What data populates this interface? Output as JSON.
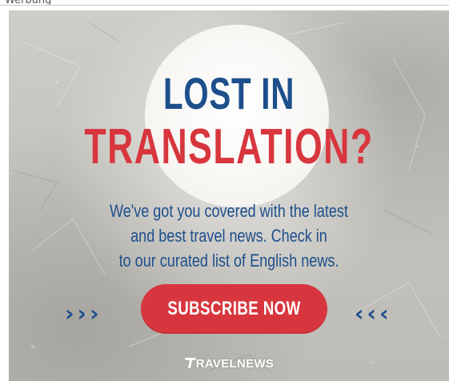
{
  "page": {
    "ad_label": "Werbung"
  },
  "banner": {
    "headline_line1": "LOST IN",
    "headline_line2": "TRANSLATION?",
    "body_line1": "We've got you covered with the latest",
    "body_line2": "and best travel news. Check in",
    "body_line3": "to our curated list of English news.",
    "chevrons_left": "›››",
    "chevrons_right": "‹‹‹",
    "cta_label": "SUBSCRIBE NOW",
    "logo_text": "RAVELNEWS",
    "logo_icon": "travelnews-t-logo-icon",
    "colors": {
      "blue": "#1d4f8c",
      "red": "#d8363e",
      "background": "#c8c6c0"
    }
  }
}
